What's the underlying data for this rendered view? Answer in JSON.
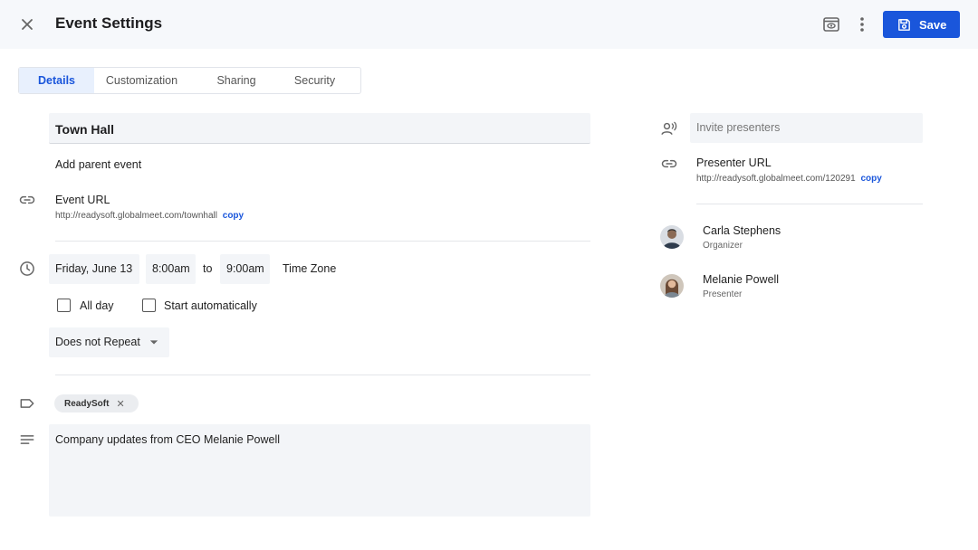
{
  "header": {
    "title": "Event Settings",
    "save_label": "Save",
    "accent": "#1a56db"
  },
  "tabs": [
    {
      "label": "Details",
      "active": true
    },
    {
      "label": "Customization",
      "active": false
    },
    {
      "label": "Sharing",
      "active": false
    },
    {
      "label": "Security",
      "active": false
    }
  ],
  "details": {
    "event_name": "Town Hall",
    "parent_event": "Add parent event",
    "event_url_label": "Event URL",
    "event_url": "http://readysoft.globalmeet.com/townhall",
    "copy_label": "copy",
    "date": "Friday, June 13",
    "start_time": "8:00am",
    "to_label": "to",
    "end_time": "9:00am",
    "timezone": "Time Zone",
    "all_day_label": "All day",
    "all_day_checked": false,
    "start_auto_label": "Start automatically",
    "start_auto_checked": false,
    "repeat": "Does not Repeat",
    "tag": "ReadySoft",
    "description": "Company updates from CEO Melanie Powell"
  },
  "presenters": {
    "invite_placeholder": "Invite presenters",
    "url_label": "Presenter URL",
    "url": "http://readysoft.globalmeet.com/120291",
    "copy_label": "copy",
    "people": [
      {
        "name": "Carla Stephens",
        "role": "Organizer"
      },
      {
        "name": "Melanie Powell",
        "role": "Presenter"
      }
    ]
  },
  "icons": [
    "close-icon",
    "preview-icon",
    "more-vertical-icon",
    "save-icon",
    "link-icon",
    "clock-icon",
    "chevron-down-icon",
    "tag-icon",
    "notes-icon",
    "presenter-voice-icon"
  ]
}
